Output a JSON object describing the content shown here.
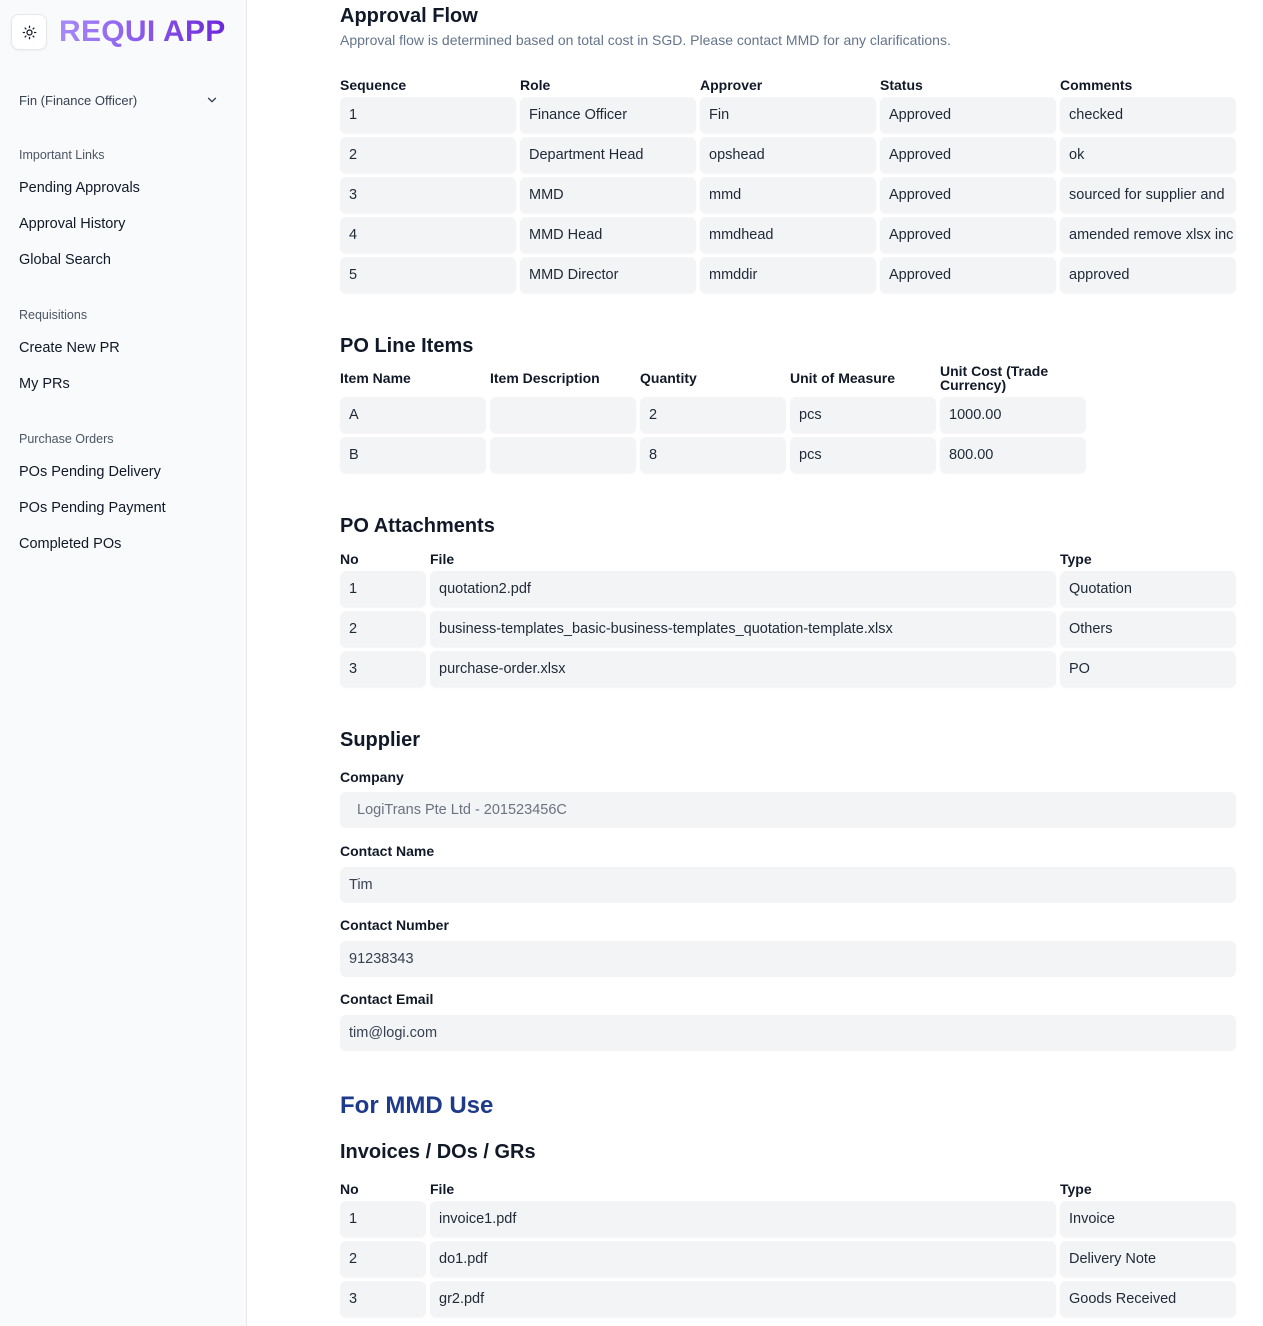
{
  "app": {
    "title": "REQUI APP",
    "theme_icon": "sun-icon"
  },
  "user": {
    "label": "Fin (Finance Officer)",
    "icon": "chevron-down-icon"
  },
  "nav": {
    "important_heading": "Important Links",
    "important": [
      "Pending Approvals",
      "Approval History",
      "Global Search"
    ],
    "req_heading": "Requisitions",
    "requisitions": [
      "Create New PR",
      "My PRs"
    ],
    "po_heading": "Purchase Orders",
    "purchase_orders": [
      "POs Pending Delivery",
      "POs Pending Payment",
      "Completed POs"
    ]
  },
  "approval": {
    "title": "Approval Flow",
    "subtitle": "Approval flow is determined based on total cost in SGD. Please contact MMD for any clarifications.",
    "columns": [
      "Sequence",
      "Role",
      "Approver",
      "Status",
      "Comments"
    ],
    "rows": [
      [
        "1",
        "Finance Officer",
        "Fin",
        "Approved",
        "checked"
      ],
      [
        "2",
        "Department Head",
        "opshead",
        "Approved",
        "ok"
      ],
      [
        "3",
        "MMD",
        "mmd",
        "Approved",
        "sourced for supplier and"
      ],
      [
        "4",
        "MMD Head",
        "mmdhead",
        "Approved",
        "amended remove xlsx inc"
      ],
      [
        "5",
        "MMD Director",
        "mmddir",
        "Approved",
        "approved"
      ]
    ]
  },
  "line_items": {
    "title": "PO Line Items",
    "columns": [
      "Item Name",
      "Item Description",
      "Quantity",
      "Unit of Measure",
      "Unit Cost (Trade Currency)"
    ],
    "rows": [
      [
        "A",
        "",
        "2",
        "pcs",
        "1000.00"
      ],
      [
        "B",
        "",
        "8",
        "pcs",
        "800.00"
      ]
    ]
  },
  "attachments": {
    "title": "PO Attachments",
    "columns": [
      "No",
      "File",
      "Type"
    ],
    "rows": [
      [
        "1",
        "quotation2.pdf",
        "Quotation"
      ],
      [
        "2",
        "business-templates_basic-business-templates_quotation-template.xlsx",
        "Others"
      ],
      [
        "3",
        "purchase-order.xlsx",
        "PO"
      ]
    ]
  },
  "supplier": {
    "title": "Supplier",
    "company_label": "Company",
    "company": "LogiTrans Pte Ltd - 201523456C",
    "contact_name_label": "Contact Name",
    "contact_name": "Tim",
    "contact_number_label": "Contact Number",
    "contact_number": "91238343",
    "contact_email_label": "Contact Email",
    "contact_email": "tim@logi.com"
  },
  "mmd": {
    "title": "For MMD Use",
    "docs_title": "Invoices / DOs / GRs",
    "columns": [
      "No",
      "File",
      "Type"
    ],
    "rows": [
      [
        "1",
        "invoice1.pdf",
        "Invoice"
      ],
      [
        "2",
        "do1.pdf",
        "Delivery Note"
      ],
      [
        "3",
        "gr2.pdf",
        "Goods Received"
      ]
    ]
  }
}
